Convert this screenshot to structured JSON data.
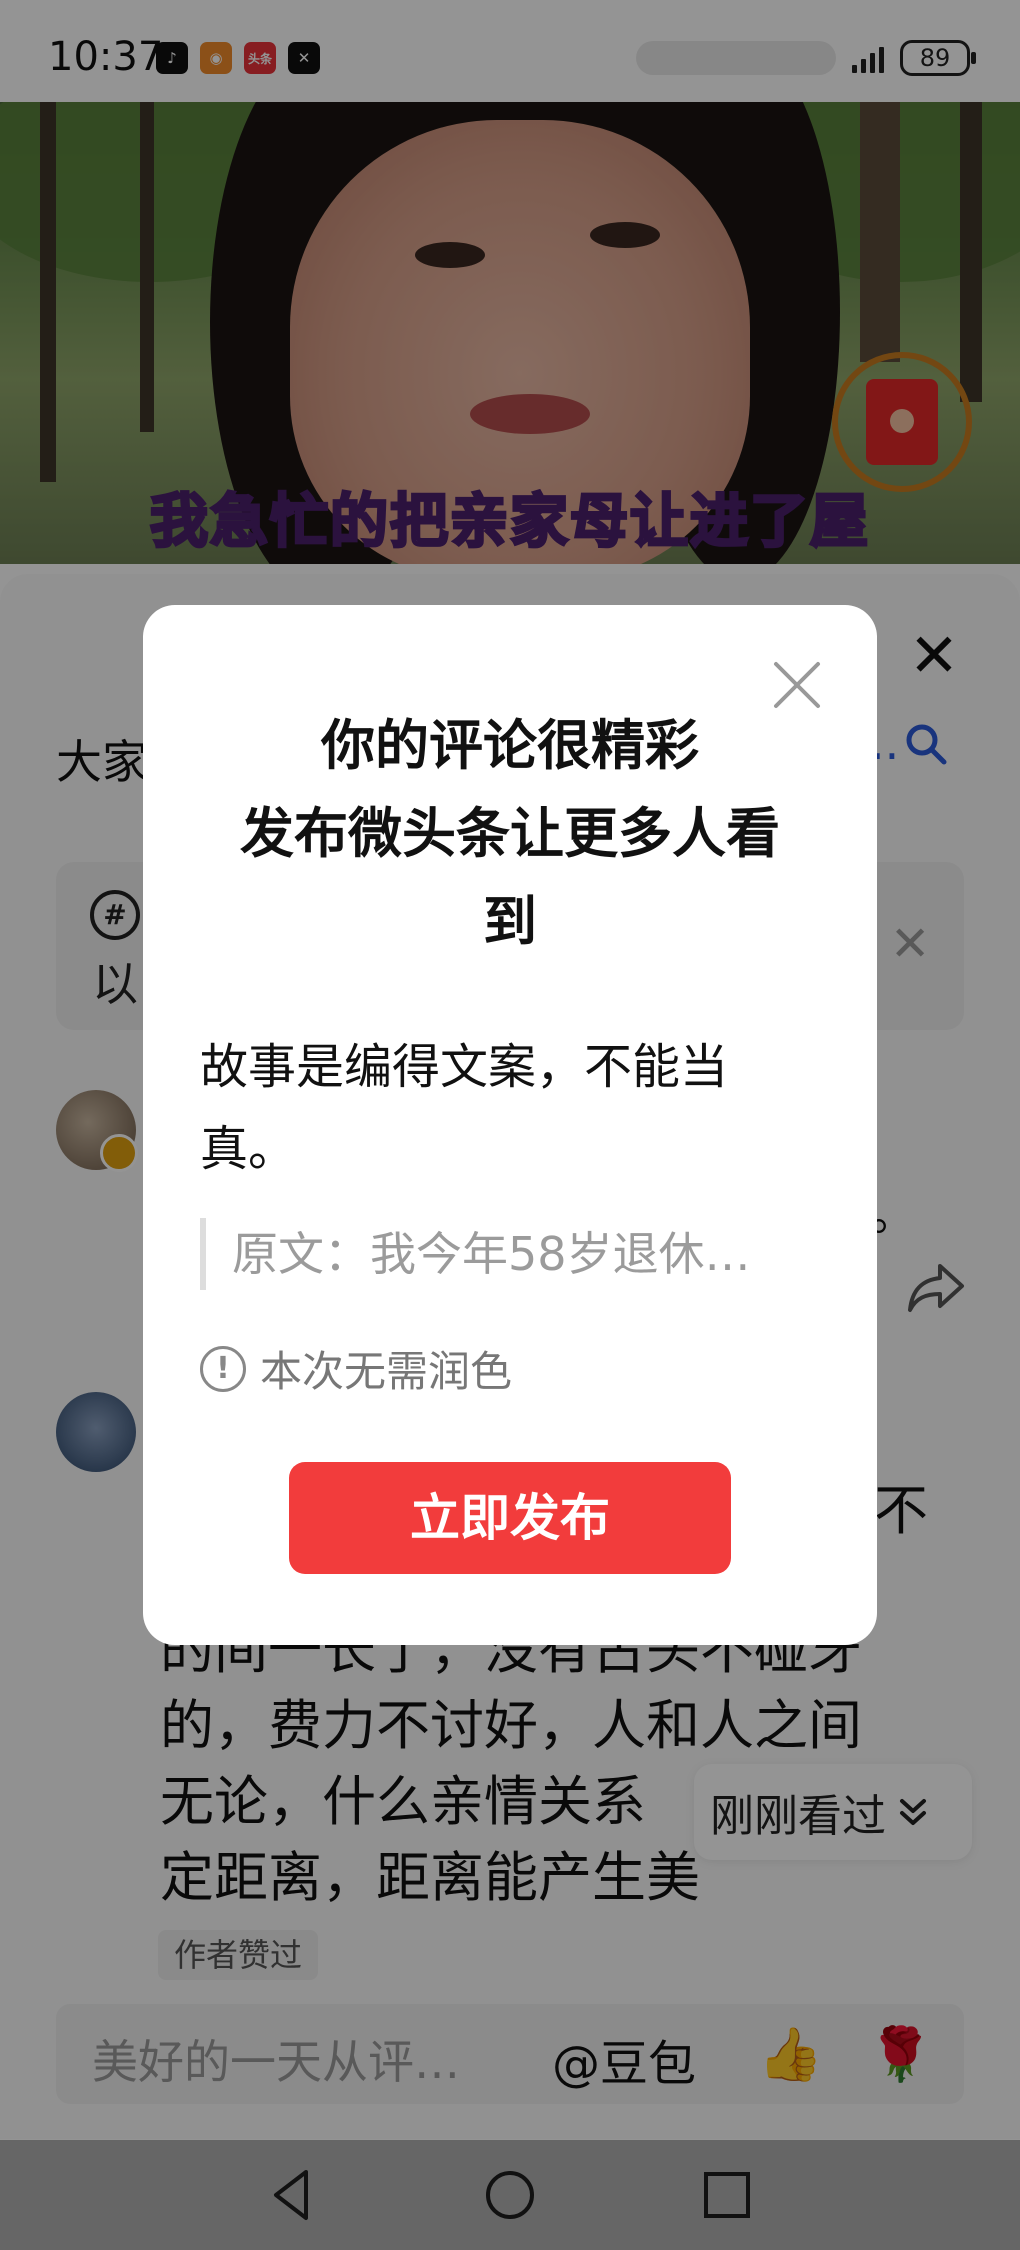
{
  "status_bar": {
    "time": "10:37",
    "apps": [
      {
        "icon": "tiktok-icon",
        "glyph": "♪",
        "color": "#111111"
      },
      {
        "icon": "weibo-app-icon",
        "glyph": "◉",
        "color": "#f08a2a"
      },
      {
        "icon": "toutiao-icon",
        "glyph": "头条",
        "color": "#e8333a"
      },
      {
        "icon": "capcut-icon",
        "glyph": "✕",
        "color": "#111111"
      }
    ],
    "battery": "89"
  },
  "video": {
    "subtitle": "我急忙的把亲家母让进了屋"
  },
  "comment_panel": {
    "title_partial": "大家",
    "title_tail": "..",
    "notice_text_partial": "以",
    "comment1_tail": "。",
    "comment2_tail": "不",
    "comment2_lines": [
      "的间一长了，没有古头不碰牙",
      "的，费力不讨好，人和人之间",
      "无论，什么亲情关系",
      "定距离，距离能产生美"
    ],
    "author_liked": "作者赞过",
    "recently_viewed": "刚刚看过",
    "input_placeholder": "美好的一天从评…",
    "doubao_mention": "@豆包",
    "thumb_glyph": "👍",
    "flower_glyph": "🌹"
  },
  "dialog": {
    "title_lines": [
      "你的评论很精彩",
      "发布微头条让更多人看",
      "到"
    ],
    "body_lines": [
      "故事是编得文案，不能当",
      "真。"
    ],
    "quote": "原文：我今年58岁退休…",
    "hint": "本次无需润色",
    "publish_button": "立即发布"
  },
  "colors": {
    "accent_red": "#f23c3c",
    "link_blue": "#2b5ad8",
    "subtitle_purple": "#b07bd8"
  }
}
